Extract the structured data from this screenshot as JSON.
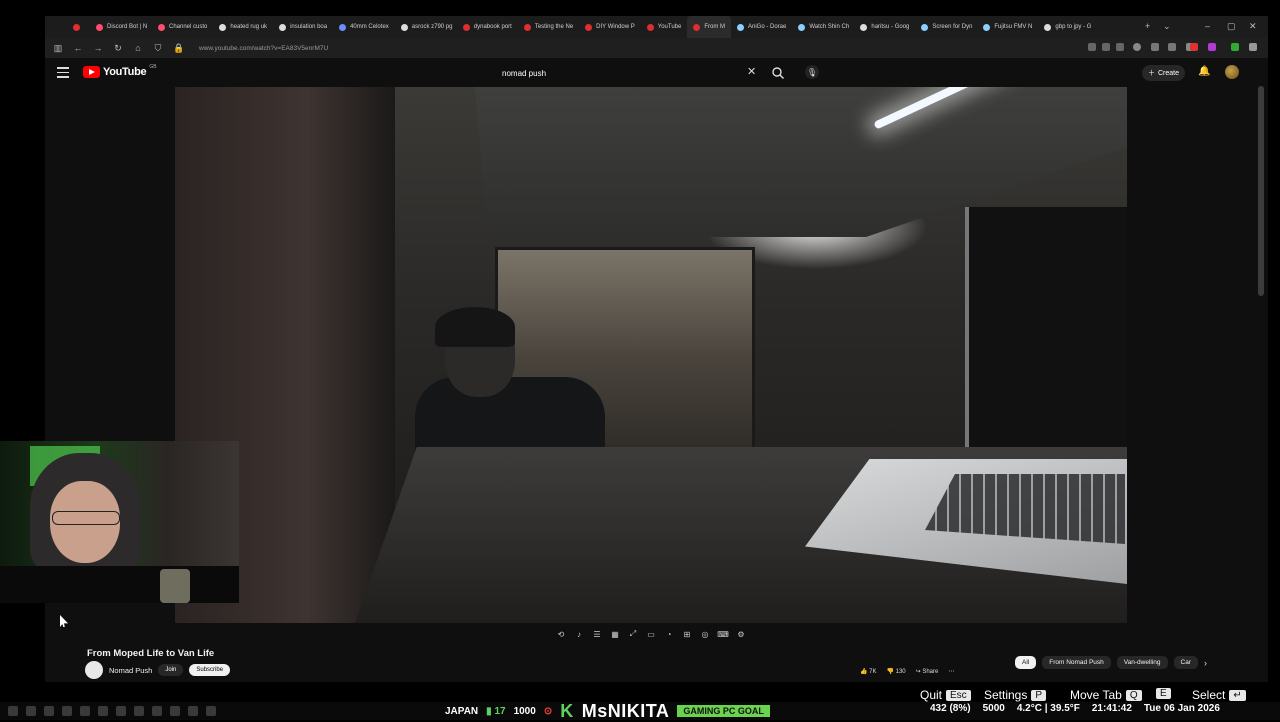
{
  "browser": {
    "tabs": [
      {
        "label": "",
        "color": "#e02d2d"
      },
      {
        "label": "Discord Bot | N",
        "color": "#ff4d6d"
      },
      {
        "label": "Channel custo",
        "color": "#ff4d6d"
      },
      {
        "label": "heated rug uk",
        "color": "#dddddd"
      },
      {
        "label": "insulation boa",
        "color": "#dddddd"
      },
      {
        "label": "40mm Celotex",
        "color": "#6b8cff"
      },
      {
        "label": "asrock z790 pg",
        "color": "#dddddd"
      },
      {
        "label": "dynabook port",
        "color": "#e02d2d"
      },
      {
        "label": "Testing the Ne",
        "color": "#e02d2d"
      },
      {
        "label": "DIY Window P",
        "color": "#e02d2d"
      },
      {
        "label": "YouTube",
        "color": "#e02d2d"
      },
      {
        "label": "From M",
        "color": "#e02d2d"
      },
      {
        "label": "AniGo - Dorae",
        "color": "#8ad0ff"
      },
      {
        "label": "Watch Shin Ch",
        "color": "#8ad0ff"
      },
      {
        "label": "haritsu - Goog",
        "color": "#dddddd"
      },
      {
        "label": "Screen for Dyn",
        "color": "#8ad0ff"
      },
      {
        "label": "Fujitsu FMV N",
        "color": "#8ad0ff"
      },
      {
        "label": "gbp to jpy - G",
        "color": "#dddddd"
      }
    ],
    "url": "www.youtube.com/watch?v=EA83V5enrM7U"
  },
  "youtube": {
    "logo_text": "YouTube",
    "country": "GB",
    "search_value": "nomad push",
    "create_label": "Create"
  },
  "video": {
    "title": "From Moped Life to Van Life",
    "channel": "Nomad Push",
    "join_label": "Join",
    "subscribe_label": "Subscribe",
    "likes": "7K",
    "dislikes": "130",
    "share_label": "Share",
    "chips": [
      "All",
      "From Nomad Push",
      "Van-dwelling",
      "Car"
    ]
  },
  "overlay": {
    "hints": [
      {
        "label": "Quit",
        "key": "Esc"
      },
      {
        "label": "Settings",
        "key": "P"
      },
      {
        "label": "Move Tab",
        "key": "Q"
      },
      {
        "label": "",
        "key": "E"
      },
      {
        "label": "Select",
        "key": "↵"
      }
    ],
    "ticker": {
      "country": "JAPAN",
      "count": "17",
      "total": "1000",
      "name": "MsNIKITA",
      "goal": "GAMING PC GOAL",
      "progress": "432 (8%)",
      "goal_target": "5000",
      "weather": "4.2°C | 39.5°F",
      "time": "21:41:42",
      "date": "Tue 06 Jan 2026"
    }
  }
}
